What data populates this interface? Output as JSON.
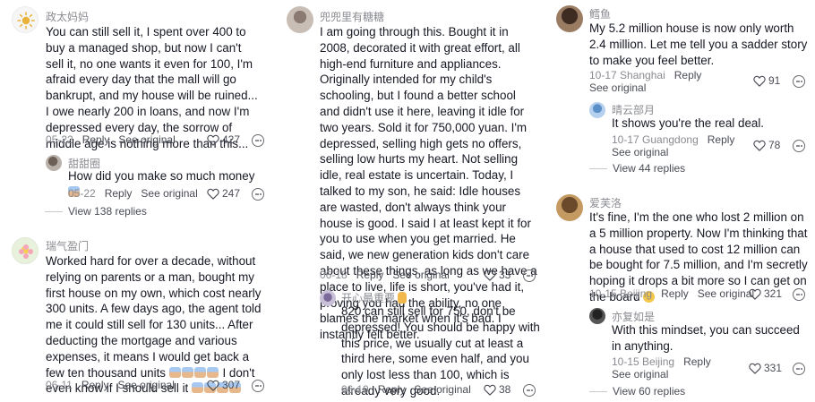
{
  "columns": [
    {
      "comments": [
        {
          "name": "政太妈妈",
          "text": "You can still sell it, I spent over 400 to buy a managed shop, but now I can't sell it, no one wants it even for 100, I'm afraid every day that the mall will go bankrupt, and my house will be ruined... I owe nearly 200 in loans, and now I'm depressed every day, the sorrow of middle age is nothing more than this...",
          "date": "05-22",
          "reply": "Reply",
          "see_original": "See original",
          "likes": "427",
          "avatar_icon": "sun-icon"
        },
        {
          "name": "甜甜圈",
          "text": "How did you make so much money",
          "date": "05-22",
          "reply": "Reply",
          "see_original": "See original",
          "likes": "247",
          "avatar_icon": "user-avatar-photo"
        }
      ],
      "view_replies": "View 138 replies"
    },
    {
      "comments": [
        {
          "name": "瑞气盈门",
          "text": "Worked hard for over a decade, without relying on parents or a man, bought my first house on my own, which cost nearly 300 units. A few days ago, the agent told me it could still sell for 130 units... After deducting the mortgage and various expenses, it means I would get back a few ten thousand units",
          "text_tail": " I don't even know if I should sell it",
          "date": "06-11",
          "reply": "Reply",
          "see_original": "See original",
          "likes": "307",
          "avatar_icon": "flower-avatar"
        }
      ]
    },
    {
      "comments": [
        {
          "name": "兜兜里有糖糖",
          "text": "I am going through this. Bought it in 2008, decorated it with great effort, all high-end furniture and appliances. Originally intended for my child's schooling, but I found a better school and didn't use it here, leaving it idle for two years. Sold it for 750,000 yuan. I'm depressed, selling high gets no offers, selling low hurts my heart. Not selling idle, real estate is uncertain. Today, I talked to my son, he said: Idle houses are wasted, don't always think your house is good. I said I at least kept it for you to use when you get married. He said, we new generation kids don't care about these things, as long as we have a place to live, life is short, you've had it, proving you had the ability, no one blames the market when it's bad. I instantly felt better.",
          "date": "06-18",
          "reply": "Reply",
          "see_original": "See original",
          "likes": "33",
          "avatar_icon": "user-avatar-photo"
        },
        {
          "name": "开心最重要",
          "text": "820 can still sell for 750, don't be depressed! You should be happy with this price, we usually cut at least a third here, some even half, and you only lost less than 100, which is already very good.",
          "date": "06-19",
          "reply": "Reply",
          "see_original": "See original",
          "likes": "38",
          "avatar_icon": "user-avatar-photo"
        }
      ]
    },
    {
      "comments": [
        {
          "name": "鳕鱼",
          "text": "My 5.2 million house is now only worth 2.4 million. Let me tell you a sadder story to make you feel better.",
          "date": "10-17 Shanghai",
          "reply": "Reply",
          "see_original": "See original",
          "likes": "91",
          "avatar_icon": "user-avatar-photo"
        },
        {
          "name": "晴云部月",
          "text": "It shows you're the real deal.",
          "date": "10-17 Guangdong",
          "reply": "Reply",
          "see_original": "See original",
          "likes": "78",
          "avatar_icon": "user-avatar-photo"
        }
      ],
      "view_replies": "View 44 replies"
    },
    {
      "comments": [
        {
          "name": "爱芙洛",
          "text": "It's fine, I'm the one who lost 2 million on a 5 million property. Now I'm thinking that a house that used to cost 12 million can be bought for 7.5 million, and I'm secretly hoping it drops a bit more so I can get on the board",
          "date": "10-15 Beijing",
          "reply": "Reply",
          "see_original": "See original",
          "likes": "321",
          "avatar_icon": "user-avatar-photo"
        },
        {
          "name": "亦复如是",
          "text": "With this mindset, you can succeed in anything.",
          "date": "10-15 Beijing",
          "reply": "Reply",
          "see_original": "See original",
          "likes": "331",
          "avatar_icon": "user-avatar-photo"
        }
      ],
      "view_replies": "View 60 replies"
    }
  ],
  "colors": {
    "text": "#161823",
    "muted": "#8a8b91",
    "action": "#4a4c55"
  }
}
